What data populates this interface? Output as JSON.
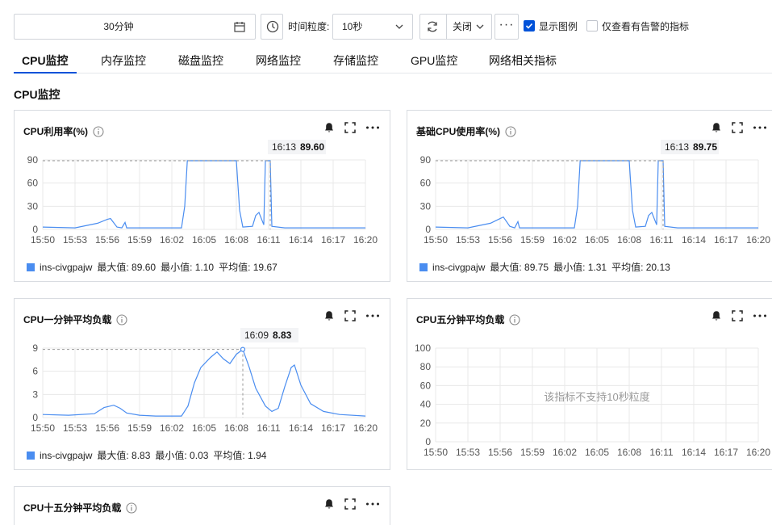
{
  "toolbar": {
    "time_range": "30分钟",
    "granularity_label": "时间粒度:",
    "granularity_value": "10秒",
    "refresh_value": "关闭",
    "more": "···",
    "show_legend_label": "显示图例",
    "alert_only_label": "仅查看有告警的指标",
    "show_legend_checked": true,
    "alert_only_checked": false
  },
  "tabs": [
    {
      "label": "CPU监控",
      "active": true
    },
    {
      "label": "内存监控",
      "active": false
    },
    {
      "label": "磁盘监控",
      "active": false
    },
    {
      "label": "网络监控",
      "active": false
    },
    {
      "label": "存储监控",
      "active": false
    },
    {
      "label": "GPU监控",
      "active": false
    },
    {
      "label": "网络相关指标",
      "active": false
    }
  ],
  "section_title": "CPU监控",
  "colors": {
    "accent": "#0052d9",
    "series": "#4a8df0",
    "grid": "#e8e8e8"
  },
  "cards": [
    {
      "title": "CPU利用率(%)",
      "tooltip": {
        "time": "16:13",
        "value": "89.60"
      },
      "legend": {
        "instance": "ins-civgpajw",
        "max": "最大值: 89.60",
        "min": "最小值: 1.10",
        "avg": "平均值: 19.67"
      }
    },
    {
      "title": "基础CPU使用率(%)",
      "tooltip": {
        "time": "16:13",
        "value": "89.75"
      },
      "legend": {
        "instance": "ins-civgpajw",
        "max": "最大值: 89.75",
        "min": "最小值: 1.31",
        "avg": "平均值: 20.13"
      }
    },
    {
      "title": "CPU一分钟平均负载",
      "tooltip": {
        "time": "16:09",
        "value": "8.83"
      },
      "legend": {
        "instance": "ins-civgpajw",
        "max": "最大值: 8.83",
        "min": "最小值: 0.03",
        "avg": "平均值: 1.94"
      }
    },
    {
      "title": "CPU五分钟平均负载",
      "no_data": "该指标不支持10秒粒度"
    },
    {
      "title": "CPU十五分钟平均负载"
    }
  ],
  "chart_data": [
    {
      "type": "line",
      "title": "CPU利用率(%)",
      "x": [
        "15:50",
        "15:53",
        "15:56",
        "15:59",
        "16:02",
        "16:05",
        "16:08",
        "16:11",
        "16:14",
        "16:17",
        "16:20"
      ],
      "ylim": [
        0,
        90
      ],
      "yticks": [
        0,
        30,
        60,
        90
      ],
      "series": [
        {
          "name": "ins-civgpajw",
          "values": [
            [
              0,
              3
            ],
            [
              1,
              2
            ],
            [
              1.7,
              8
            ],
            [
              2,
              13
            ],
            [
              2.1,
              14
            ],
            [
              2.3,
              3
            ],
            [
              2.45,
              2
            ],
            [
              2.55,
              9
            ],
            [
              2.6,
              2
            ],
            [
              3,
              2
            ],
            [
              3.5,
              2
            ],
            [
              4.3,
              2
            ],
            [
              4.4,
              30
            ],
            [
              4.48,
              89
            ],
            [
              5,
              89
            ],
            [
              5.8,
              89
            ],
            [
              6,
              89
            ],
            [
              6.1,
              25
            ],
            [
              6.2,
              3
            ],
            [
              6.5,
              4
            ],
            [
              6.6,
              18
            ],
            [
              6.7,
              22
            ],
            [
              6.85,
              6
            ],
            [
              6.9,
              89
            ],
            [
              7.05,
              89
            ],
            [
              7.1,
              4
            ],
            [
              7.5,
              2
            ],
            [
              8.5,
              2
            ],
            [
              9.5,
              2
            ],
            [
              10,
              2
            ]
          ]
        }
      ]
    },
    {
      "type": "line",
      "title": "基础CPU使用率(%)",
      "x": [
        "15:50",
        "15:53",
        "15:56",
        "15:59",
        "16:02",
        "16:05",
        "16:08",
        "16:11",
        "16:14",
        "16:17",
        "16:20"
      ],
      "ylim": [
        0,
        90
      ],
      "yticks": [
        0,
        30,
        60,
        90
      ],
      "series": [
        {
          "name": "ins-civgpajw",
          "values": [
            [
              0,
              3
            ],
            [
              1,
              2
            ],
            [
              1.7,
              8
            ],
            [
              2,
              14
            ],
            [
              2.1,
              16
            ],
            [
              2.3,
              4
            ],
            [
              2.45,
              2
            ],
            [
              2.55,
              10
            ],
            [
              2.6,
              2
            ],
            [
              3,
              2
            ],
            [
              3.5,
              2
            ],
            [
              4.3,
              2
            ],
            [
              4.4,
              30
            ],
            [
              4.48,
              89
            ],
            [
              5,
              89
            ],
            [
              5.8,
              89
            ],
            [
              6,
              89
            ],
            [
              6.1,
              25
            ],
            [
              6.2,
              3
            ],
            [
              6.5,
              4
            ],
            [
              6.6,
              18
            ],
            [
              6.7,
              22
            ],
            [
              6.85,
              6
            ],
            [
              6.9,
              89
            ],
            [
              7.05,
              89
            ],
            [
              7.1,
              4
            ],
            [
              7.5,
              2
            ],
            [
              8.5,
              2
            ],
            [
              9.5,
              2
            ],
            [
              10,
              2
            ]
          ]
        }
      ]
    },
    {
      "type": "line",
      "title": "CPU一分钟平均负载",
      "x": [
        "15:50",
        "15:53",
        "15:56",
        "15:59",
        "16:02",
        "16:05",
        "16:08",
        "16:11",
        "16:14",
        "16:17",
        "16:20"
      ],
      "ylim": [
        0,
        9
      ],
      "yticks": [
        0,
        3,
        6,
        9
      ],
      "series": [
        {
          "name": "ins-civgpajw",
          "values": [
            [
              0,
              0.4
            ],
            [
              0.8,
              0.3
            ],
            [
              1.6,
              0.5
            ],
            [
              1.9,
              1.3
            ],
            [
              2.2,
              1.6
            ],
            [
              2.4,
              1.2
            ],
            [
              2.6,
              0.6
            ],
            [
              3,
              0.3
            ],
            [
              3.5,
              0.2
            ],
            [
              4.3,
              0.2
            ],
            [
              4.5,
              1.5
            ],
            [
              4.7,
              4.5
            ],
            [
              4.9,
              6.5
            ],
            [
              5.2,
              7.8
            ],
            [
              5.4,
              8.5
            ],
            [
              5.6,
              7.6
            ],
            [
              5.8,
              7.0
            ],
            [
              6.0,
              8.2
            ],
            [
              6.2,
              8.83
            ],
            [
              6.4,
              6.5
            ],
            [
              6.6,
              3.8
            ],
            [
              6.9,
              1.5
            ],
            [
              7.1,
              0.8
            ],
            [
              7.3,
              1.2
            ],
            [
              7.5,
              4.0
            ],
            [
              7.7,
              6.5
            ],
            [
              7.8,
              6.8
            ],
            [
              8.0,
              4.2
            ],
            [
              8.3,
              1.8
            ],
            [
              8.7,
              0.8
            ],
            [
              9.2,
              0.4
            ],
            [
              10,
              0.2
            ]
          ]
        }
      ]
    },
    {
      "type": "line",
      "title": "CPU五分钟平均负载",
      "x": [
        "15:50",
        "15:53",
        "15:56",
        "15:59",
        "16:02",
        "16:05",
        "16:08",
        "16:11",
        "16:14",
        "16:17",
        "16:20"
      ],
      "ylim": [
        0,
        100
      ],
      "yticks": [
        0,
        20,
        40,
        60,
        80,
        100
      ],
      "series": []
    }
  ]
}
